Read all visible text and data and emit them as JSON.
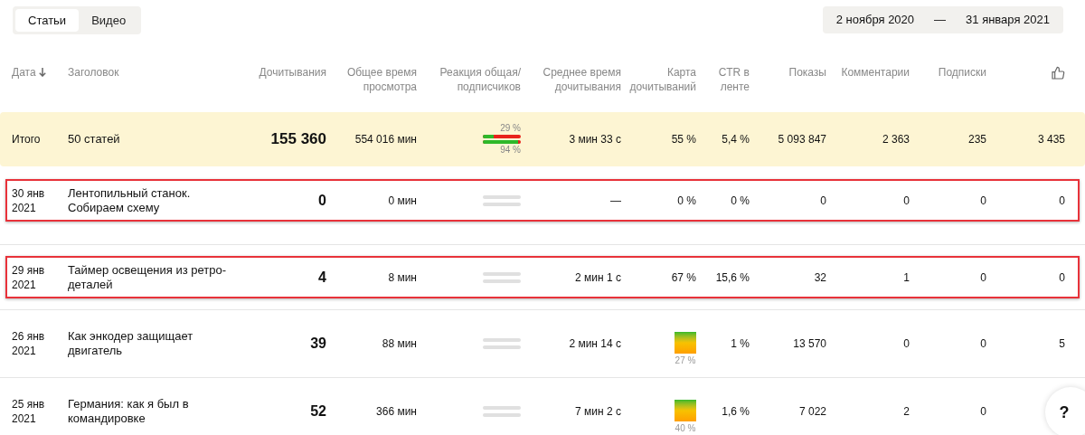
{
  "tabs": [
    {
      "label": "Статьи",
      "selected": true
    },
    {
      "label": "Видео",
      "selected": false
    }
  ],
  "date_range": {
    "from": "2 ноября 2020",
    "separator": "—",
    "to": "31 января 2021"
  },
  "table": {
    "columns": [
      {
        "label": "Дата",
        "sorted": true
      },
      {
        "label": "Заголовок"
      },
      {
        "label": "Дочитывания"
      },
      {
        "label": "Общее время просмотра"
      },
      {
        "label": "Реакция общая/ подписчиков"
      },
      {
        "label": "Среднее время дочитывания"
      },
      {
        "label": "Карта дочитываний"
      },
      {
        "label": "CTR в ленте"
      },
      {
        "label": "Показы"
      },
      {
        "label": "Комментарии"
      },
      {
        "label": "Подписки"
      },
      {
        "kind": "like-icon"
      }
    ],
    "summary": {
      "date": "Итого",
      "title": "50 статей",
      "reads": "155 360",
      "total_time": "554 016 мин",
      "reaction": {
        "kind": "bars",
        "bars": [
          {
            "label": "29 %",
            "level": 0.29
          },
          {
            "label": "94 %",
            "level": 0.94
          }
        ]
      },
      "avg_time": "3 мин 33 с",
      "map": {
        "kind": "text",
        "text": "55 %"
      },
      "ctr": "5,4 %",
      "views": "5 093 847",
      "comments": "2 363",
      "subs": "235",
      "likes": "3 435"
    },
    "rows": [
      {
        "highlighted": true,
        "date": "30 янв 2021",
        "title": "Лентопильный станок. Собираем схему",
        "reads": "0",
        "total_time": "0 мин",
        "reaction": {
          "kind": "empty"
        },
        "avg_time": "—",
        "map": {
          "kind": "text",
          "text": "0 %"
        },
        "ctr": "0 %",
        "views": "0",
        "comments": "0",
        "subs": "0",
        "likes": "0"
      },
      {
        "highlighted": true,
        "date": "29 янв 2021",
        "title": "Таймер освещения из ретро-деталей",
        "reads": "4",
        "total_time": "8 мин",
        "reaction": {
          "kind": "empty"
        },
        "avg_time": "2 мин 1 с",
        "map": {
          "kind": "text",
          "text": "67 %"
        },
        "ctr": "15,6 %",
        "views": "32",
        "comments": "1",
        "subs": "0",
        "likes": "0"
      },
      {
        "highlighted": false,
        "date": "26 янв 2021",
        "title": "Как энкодер защищает двигатель",
        "reads": "39",
        "total_time": "88 мин",
        "reaction": {
          "kind": "empty"
        },
        "avg_time": "2 мин 14 с",
        "map": {
          "kind": "chart",
          "text": "27 %"
        },
        "ctr": "1 %",
        "views": "13 570",
        "comments": "0",
        "subs": "0",
        "likes": "5"
      },
      {
        "highlighted": false,
        "date": "25 янв 2021",
        "title": "Германия: как я был в командировке",
        "reads": "52",
        "total_time": "366 мин",
        "reaction": {
          "kind": "empty"
        },
        "avg_time": "7 мин 2 с",
        "map": {
          "kind": "chart",
          "text": "40 %"
        },
        "ctr": "1,6 %",
        "views": "7 022",
        "comments": "2",
        "subs": "0"
      }
    ]
  },
  "help_button": {
    "label": "?"
  }
}
